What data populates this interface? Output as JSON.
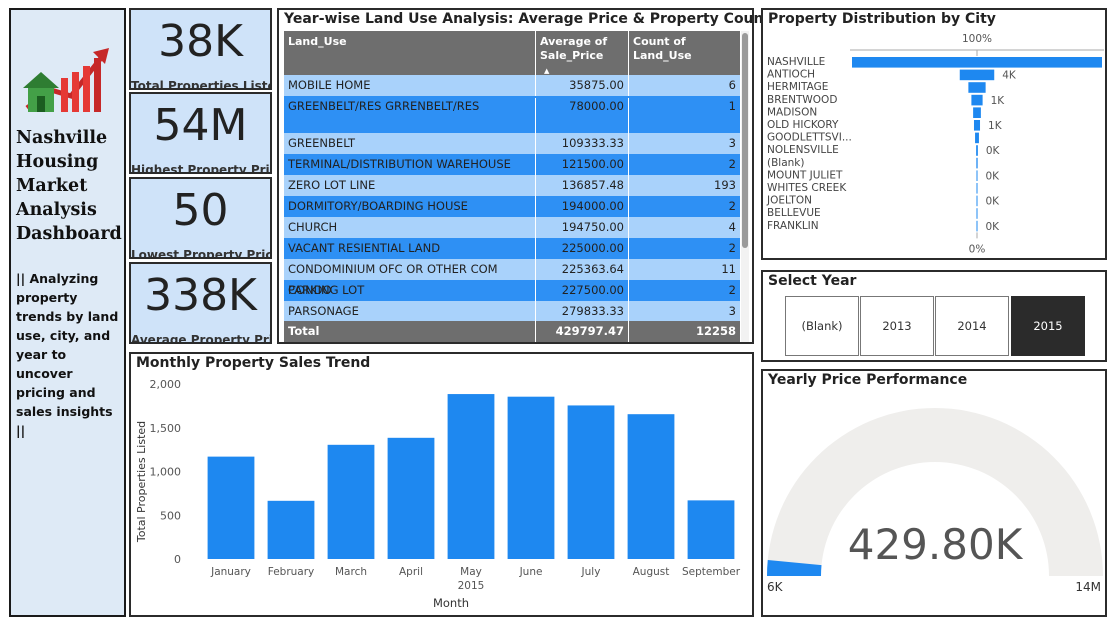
{
  "sidebar": {
    "title": "Nashville Housing Market Analysis Dashboard",
    "description": "|| Analyzing property trends by land use, city, and year to uncover pricing and sales insights ||"
  },
  "kpis": [
    {
      "value": "38K",
      "label": "Total Properties Listed"
    },
    {
      "value": "54M",
      "label": "Highest Property Price"
    },
    {
      "value": "50",
      "label": "Lowest Property Price"
    },
    {
      "value": "338K",
      "label": "Average Property Price"
    }
  ],
  "land_use_table": {
    "title": "Year-wise Land Use Analysis: Average Price & Property Count",
    "columns": [
      "Land_Use",
      "Average of Sale_Price",
      "Count of Land_Use"
    ],
    "rows": [
      [
        "MOBILE HOME",
        "35875.00",
        "6"
      ],
      [
        "GREENBELT/RES GRRENBELT/RES",
        "78000.00",
        "1"
      ],
      [
        "GREENBELT",
        "109333.33",
        "3"
      ],
      [
        "TERMINAL/DISTRIBUTION WAREHOUSE",
        "121500.00",
        "2"
      ],
      [
        "ZERO LOT LINE",
        "136857.48",
        "193"
      ],
      [
        "DORMITORY/BOARDING HOUSE",
        "194000.00",
        "2"
      ],
      [
        "CHURCH",
        "194750.00",
        "4"
      ],
      [
        "VACANT RESIENTIAL LAND",
        "225000.00",
        "2"
      ],
      [
        "CONDOMINIUM OFC OR OTHER COM CONDO",
        "225363.64",
        "11"
      ],
      [
        "PARKING LOT",
        "227500.00",
        "2"
      ],
      [
        "PARSONAGE",
        "279833.33",
        "3"
      ]
    ],
    "total": [
      "Total",
      "429797.47",
      "12258"
    ]
  },
  "monthly_chart": {
    "title": "Monthly Property Sales Trend",
    "chart_data": {
      "type": "bar",
      "title": "Monthly Property Sales Trend",
      "categories": [
        "January",
        "February",
        "March",
        "April",
        "May",
        "June",
        "July",
        "August",
        "September"
      ],
      "values": [
        1170,
        665,
        1305,
        1385,
        1885,
        1855,
        1755,
        1655,
        670
      ],
      "xlabel": "Month",
      "x_sublabel": "2015",
      "ylabel": "Total Properties Listed",
      "ylim": [
        0,
        2000
      ],
      "yticks": [
        "0",
        "500",
        "1,000",
        "1,500",
        "2,000"
      ],
      "color": "#1e88f0"
    }
  },
  "city_chart": {
    "title": "Property Distribution by City",
    "top_label": "100%",
    "bottom_label": "0%",
    "chart_data": {
      "type": "bar",
      "orientation": "funnel",
      "categories": [
        "NASHVILLE",
        "ANTIOCH",
        "HERMITAGE",
        "BRENTWOOD",
        "MADISON",
        "OLD HICKORY",
        "GOODLETTSVI...",
        "NOLENSVILLE",
        "(Blank)",
        "MOUNT JULIET",
        "WHITES CREEK",
        "JOELTON",
        "BELLEVUE",
        "FRANKLIN"
      ],
      "values": [
        29000,
        4000,
        2000,
        1300,
        900,
        700,
        450,
        200,
        150,
        110,
        80,
        40,
        20,
        10
      ],
      "data_labels": [
        "",
        "4K",
        "",
        "1K",
        "",
        "1K",
        "",
        "0K",
        "",
        "0K",
        "",
        "0K",
        "",
        "0K"
      ],
      "color": "#1e88f0"
    }
  },
  "year_slicer": {
    "title": "Select Year",
    "options": [
      "(Blank)",
      "2013",
      "2014",
      "2015"
    ],
    "selected": "2015"
  },
  "gauge": {
    "title": "Yearly Price Performance",
    "value_label": "429.80K",
    "min_label": "6K",
    "max_label": "14M",
    "value": 429797.47,
    "min": 6000,
    "max": 14000000,
    "fill_color": "#1e88f0",
    "track_color": "#efeeec"
  }
}
